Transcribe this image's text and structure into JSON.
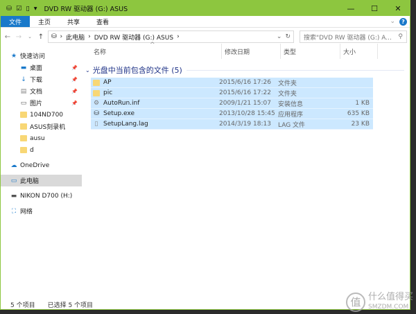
{
  "window": {
    "title": "DVD RW 驱动器 (G:) ASUS",
    "accent": "#8dc63f"
  },
  "ribbon": {
    "tabs": [
      "文件",
      "主页",
      "共享",
      "查看"
    ]
  },
  "address": {
    "crumbs": [
      "此电脑",
      "DVD RW 驱动器 (G:) ASUS"
    ],
    "search_placeholder": "搜索\"DVD RW 驱动器 (G:) A..."
  },
  "sidebar": {
    "items": [
      {
        "label": "快速访问",
        "icon": "star-icon",
        "sub": false
      },
      {
        "label": "桌面",
        "icon": "desktop-icon",
        "sub": true,
        "pin": true
      },
      {
        "label": "下载",
        "icon": "download-icon",
        "sub": true,
        "pin": true
      },
      {
        "label": "文档",
        "icon": "document-icon",
        "sub": true,
        "pin": true
      },
      {
        "label": "图片",
        "icon": "pictures-icon",
        "sub": true,
        "pin": true
      },
      {
        "label": "104ND700",
        "icon": "folder-icon",
        "sub": true
      },
      {
        "label": "ASUS刻录机",
        "icon": "folder-icon",
        "sub": true
      },
      {
        "label": "ausu",
        "icon": "folder-icon",
        "sub": true
      },
      {
        "label": "d",
        "icon": "folder-icon",
        "sub": true
      },
      {
        "label": "OneDrive",
        "icon": "cloud-icon",
        "sub": false
      },
      {
        "label": "此电脑",
        "icon": "computer-icon",
        "sub": false,
        "selected": true
      },
      {
        "label": "NIKON D700 (H:)",
        "icon": "drive-icon",
        "sub": false
      },
      {
        "label": "网络",
        "icon": "network-icon",
        "sub": false
      }
    ]
  },
  "columns": [
    "名称",
    "修改日期",
    "类型",
    "大小"
  ],
  "group": "光盘中当前包含的文件 (5)",
  "files": [
    {
      "name": "AP",
      "date": "2015/6/16 17:26",
      "type": "文件夹",
      "size": "",
      "icon": "folder-icon"
    },
    {
      "name": "pic",
      "date": "2015/6/16 17:22",
      "type": "文件夹",
      "size": "",
      "icon": "folder-icon"
    },
    {
      "name": "AutoRun.inf",
      "date": "2009/1/21 15:07",
      "type": "安装信息",
      "size": "1 KB",
      "icon": "settings-file-icon"
    },
    {
      "name": "Setup.exe",
      "date": "2013/10/28 15:45",
      "type": "应用程序",
      "size": "635 KB",
      "icon": "setup-icon"
    },
    {
      "name": "SetupLang.lag",
      "date": "2014/3/19 18:13",
      "type": "LAG 文件",
      "size": "23 KB",
      "icon": "file-icon"
    }
  ],
  "status": {
    "count": "5 个项目",
    "selected": "已选择 5 个项目"
  },
  "watermark": {
    "seal": "值",
    "text": "什么值得买",
    "sub": "SMZDM.COM"
  }
}
